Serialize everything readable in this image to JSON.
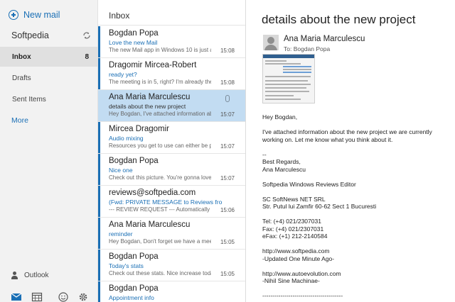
{
  "sidebar": {
    "new_mail_label": "New mail",
    "account_name": "Softpedia",
    "folders": [
      {
        "label": "Inbox",
        "count": "8"
      },
      {
        "label": "Drafts",
        "count": ""
      },
      {
        "label": "Sent Items",
        "count": ""
      }
    ],
    "more_label": "More",
    "outlook_label": "Outlook",
    "bottom_icons": [
      "mail-icon",
      "calendar-icon",
      "smiley-icon",
      "gear-icon"
    ]
  },
  "list": {
    "title": "Inbox",
    "messages": [
      {
        "sender": "Bogdan Popa",
        "subject": "Love the new Mail",
        "preview": "The new Mail app in Windows 10 is just av",
        "time": "15:08",
        "selected": false,
        "attachment": false
      },
      {
        "sender": "Dragomir Mircea-Robert",
        "subject": "ready yet?",
        "preview": "The meeting is in 5, right? I'm already the",
        "time": "15:08",
        "selected": false,
        "attachment": false
      },
      {
        "sender": "Ana Maria Marculescu",
        "subject": "details about the new project",
        "preview": "Hey Bogdan, I've attached information abo",
        "time": "15:07",
        "selected": true,
        "attachment": true
      },
      {
        "sender": "Mircea Dragomir",
        "subject": "Audio mixing",
        "preview": "Resources you get to use can either be pr",
        "time": "15:07",
        "selected": false,
        "attachment": false
      },
      {
        "sender": "Bogdan Popa",
        "subject": "Nice one",
        "preview": "Check out this picture. You're gonna love",
        "time": "15:07",
        "selected": false,
        "attachment": false
      },
      {
        "sender": "reviews@softpedia.com",
        "subject": "(Fwd: PRIVATE MESSAGE to Reviews from",
        "preview": "--- REVIEW REQUEST --- Automatically for",
        "time": "15:06",
        "selected": false,
        "attachment": false
      },
      {
        "sender": "Ana Maria Marculescu",
        "subject": "reminder",
        "preview": "Hey Bogdan, Don't forget we have a meet",
        "time": "15:05",
        "selected": false,
        "attachment": false
      },
      {
        "sender": "Bogdan Popa",
        "subject": "Today's stats",
        "preview": "Check out these stats. Nice increase today",
        "time": "15:05",
        "selected": false,
        "attachment": false
      },
      {
        "sender": "Bogdan Popa",
        "subject": "Appointment info",
        "preview": "",
        "time": "",
        "selected": false,
        "attachment": false
      }
    ]
  },
  "reading": {
    "subject": "details about the new project",
    "from": "Ana Maria Marculescu",
    "to": "To: Bogdan Popa",
    "body": [
      "Hey Bogdan,",
      "",
      "I've attached information about the new project we are currently working on. Let me know what you think about it.",
      "",
      "--",
      "Best Regards,",
      "Ana Marculescu",
      "",
      "Softpedia Windows Reviews Editor",
      "",
      "SC SoftNews NET SRL",
      "Str. Putul lui Zamfir 60-62 Sect 1 Bucuresti",
      "",
      "Tel: (+4) 021/2307031",
      "Fax: (+4) 021/2307031",
      "eFax: (+1) 212-2140584",
      "",
      "http://www.softpedia.com",
      "-Updated One Minute Ago-",
      "",
      "http://www.autoevolution.com",
      "-Nihil Sine Machinae-",
      "",
      "----------------------------------------"
    ]
  },
  "colors": {
    "accent": "#1a6fb5",
    "selected_bg": "#c2dcf2",
    "sidebar_bg": "#f2f2f2"
  }
}
